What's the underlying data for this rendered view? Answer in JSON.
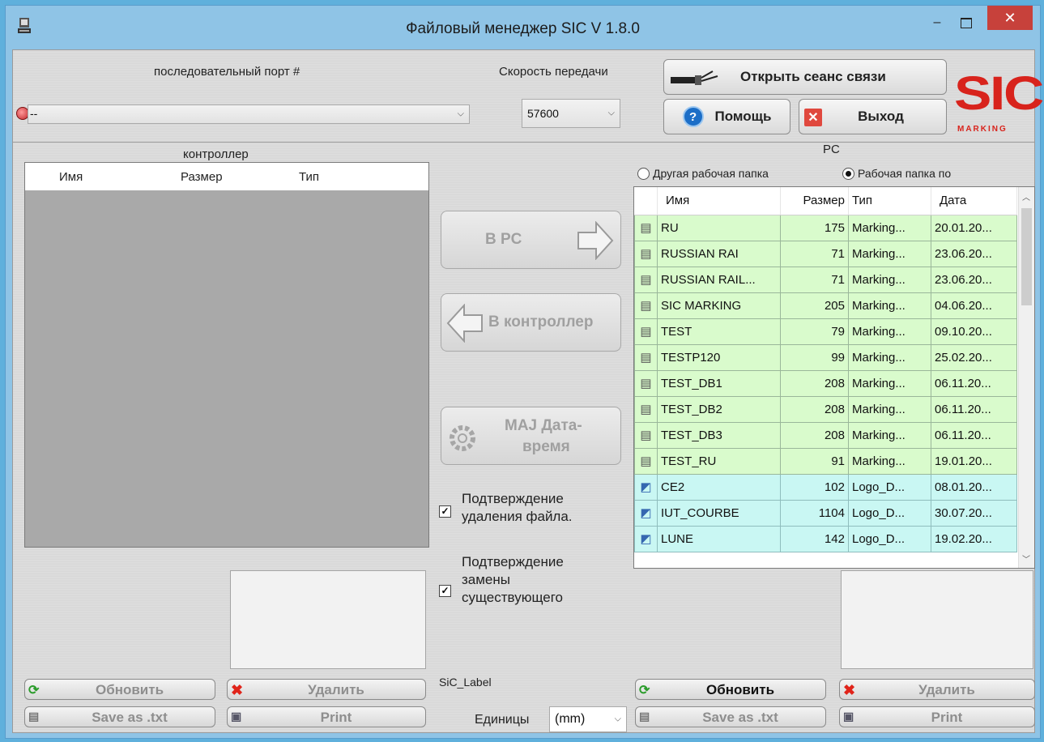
{
  "window": {
    "title": "Файловый менеджер SIC V 1.8.0",
    "min_icon": "minimize-icon",
    "max_icon": "maximize-icon",
    "close_icon": "close-icon"
  },
  "connection": {
    "port_label": "последовательный порт #",
    "port_value": "--",
    "speed_label": "Скорость передачи",
    "speed_value": "57600",
    "open_session_label": "Открыть сеанс связи",
    "help_label": "Помощь",
    "exit_label": "Выход"
  },
  "logo": {
    "text": "SIC",
    "subtext": "MARKING"
  },
  "controller": {
    "title": "контроллер",
    "columns": [
      "Имя",
      "Размер",
      "Тип"
    ],
    "refresh_label": "Обновить",
    "delete_label": "Удалить",
    "save_label": "Save as .txt",
    "print_label": "Print"
  },
  "middle": {
    "to_pc_label": "В PC",
    "to_controller_label": "В контроллер",
    "maj_label_1": "MAJ Дата-",
    "maj_label_2": "время",
    "confirm_delete_1": "Подтверждение",
    "confirm_delete_2": "удаления файла.",
    "confirm_replace_1": "Подтверждение",
    "confirm_replace_2": "замены",
    "confirm_replace_3": "существующего",
    "sic_label": "SiC_Label",
    "units_label": "Единицы",
    "units_value": "(mm)"
  },
  "pc": {
    "title": "PC",
    "radio_other": "Другая рабочая папка",
    "radio_default": "Рабочая папка по",
    "columns": [
      "Имя",
      "Размер",
      "Тип",
      "Дата"
    ],
    "files": [
      {
        "name": "RU",
        "size": "175",
        "type": "Marking...",
        "date": "20.01.20...",
        "kind": "marking"
      },
      {
        "name": "RUSSIAN RAI",
        "size": "71",
        "type": "Marking...",
        "date": "23.06.20...",
        "kind": "marking"
      },
      {
        "name": "RUSSIAN RAIL...",
        "size": "71",
        "type": "Marking...",
        "date": "23.06.20...",
        "kind": "marking"
      },
      {
        "name": "SIC MARKING",
        "size": "205",
        "type": "Marking...",
        "date": "04.06.20...",
        "kind": "marking"
      },
      {
        "name": "TEST",
        "size": "79",
        "type": "Marking...",
        "date": "09.10.20...",
        "kind": "marking"
      },
      {
        "name": "TESTP120",
        "size": "99",
        "type": "Marking...",
        "date": "25.02.20...",
        "kind": "marking"
      },
      {
        "name": "TEST_DB1",
        "size": "208",
        "type": "Marking...",
        "date": "06.11.20...",
        "kind": "marking"
      },
      {
        "name": "TEST_DB2",
        "size": "208",
        "type": "Marking...",
        "date": "06.11.20...",
        "kind": "marking"
      },
      {
        "name": "TEST_DB3",
        "size": "208",
        "type": "Marking...",
        "date": "06.11.20...",
        "kind": "marking"
      },
      {
        "name": "TEST_RU",
        "size": "91",
        "type": "Marking...",
        "date": "19.01.20...",
        "kind": "marking"
      },
      {
        "name": "CE2",
        "size": "102",
        "type": "Logo_D...",
        "date": "08.01.20...",
        "kind": "logo"
      },
      {
        "name": "IUT_COURBE",
        "size": "1104",
        "type": "Logo_D...",
        "date": "30.07.20...",
        "kind": "logo"
      },
      {
        "name": "LUNE",
        "size": "142",
        "type": "Logo_D...",
        "date": "19.02.20...",
        "kind": "logo"
      }
    ],
    "refresh_label": "Обновить",
    "delete_label": "Удалить",
    "save_label": "Save as .txt",
    "print_label": "Print"
  }
}
